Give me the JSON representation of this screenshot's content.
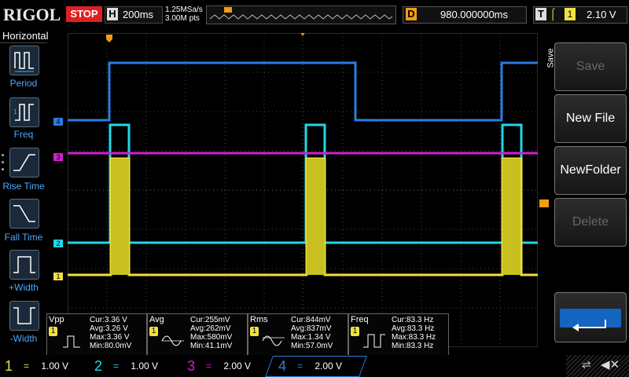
{
  "header": {
    "logo": "RIGOL",
    "run_state": "STOP",
    "timebase_label": "H",
    "timebase_value": "200ms",
    "sample_rate": "1.25MSa/s",
    "memory_depth": "3.00M pts",
    "delay_label": "D",
    "delay_value": "980.000000ms",
    "trigger_label": "T",
    "trigger_source": "1",
    "trigger_level": "2.10 V"
  },
  "left_panel": {
    "title": "Horizontal",
    "items": [
      {
        "label": "Period",
        "icon": "period-icon"
      },
      {
        "label": "Freq",
        "icon": "freq-icon"
      },
      {
        "label": "Rise Time",
        "icon": "rise-time-icon"
      },
      {
        "label": "Fall Time",
        "icon": "fall-time-icon"
      },
      {
        "label": "+Width",
        "icon": "positive-width-icon"
      },
      {
        "label": "-Width",
        "icon": "negative-width-icon"
      }
    ]
  },
  "right_panel": {
    "title": "Save",
    "buttons": [
      {
        "label": "Save",
        "enabled": false
      },
      {
        "label": "New File",
        "enabled": true
      },
      {
        "label": "NewFolder",
        "enabled": true
      },
      {
        "label": "Delete",
        "enabled": false
      }
    ],
    "enter_icon": "enter-return-icon"
  },
  "channel_markers": {
    "ch1": "1",
    "ch2": "2",
    "ch3": "3",
    "ch4": "4"
  },
  "measurements": [
    {
      "name": "Vpp",
      "channel": "1",
      "cur": "Cur:3.36 V",
      "avg": "Avg:3.26 V",
      "max": "Max:3.36 V",
      "min": "Min:80.0mV"
    },
    {
      "name": "Avg",
      "channel": "1",
      "cur": "Cur:255mV",
      "avg": "Avg:262mV",
      "max": "Max:580mV",
      "min": "Min:41.1mV"
    },
    {
      "name": "Rms",
      "channel": "1",
      "cur": "Cur:844mV",
      "avg": "Avg:837mV",
      "max": "Max:1.34 V",
      "min": "Min:57.0mV"
    },
    {
      "name": "Freq",
      "channel": "1",
      "cur": "Cur:83.3 Hz",
      "avg": "Avg:83.3 Hz",
      "max": "Max:83.3 Hz",
      "min": "Min:83.3 Hz"
    }
  ],
  "channels": [
    {
      "num": "1",
      "scale": "1.00 V",
      "color": "#f0e040"
    },
    {
      "num": "2",
      "scale": "1.00 V",
      "color": "#20d8e8"
    },
    {
      "num": "3",
      "scale": "2.00 V",
      "color": "#d020d0"
    },
    {
      "num": "4",
      "scale": "2.00 V",
      "color": "#2a7de1"
    }
  ],
  "colors": {
    "ch1": "#f0e040",
    "ch2": "#20d8e8",
    "ch3": "#d020d0",
    "ch4": "#2a7de1",
    "trigger": "#f39c12",
    "stop": "#e02020"
  },
  "status_icons": [
    "usb-icon",
    "speaker-mute-icon"
  ]
}
